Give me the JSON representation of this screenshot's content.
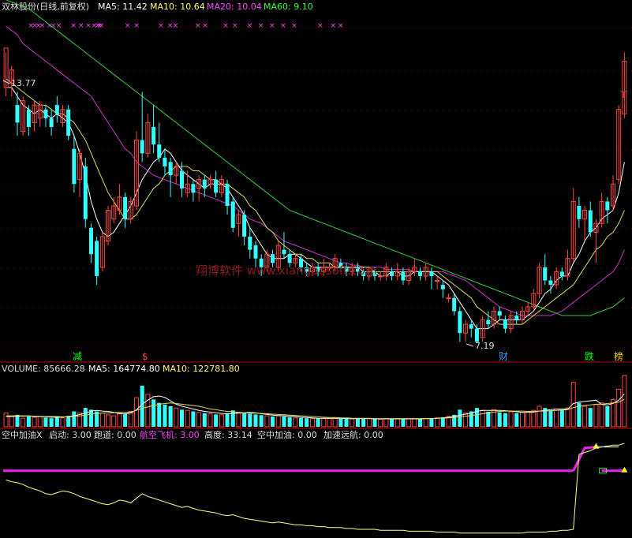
{
  "chart_data": {
    "type": "candlestick",
    "header": {
      "stock_name": "双林股份(日线,前复权)",
      "ma5": "MA5: 11.42",
      "ma10": "MA10: 10.64",
      "ma20": "MA20: 10.04",
      "ma60": "MA60: 9.10"
    },
    "price_high_label": "13.77",
    "price_low_label": "7.19",
    "watermark": "翔博软件 www.xiangbosoft.com",
    "markers": [
      {
        "text": "减",
        "color": "#00ff00"
      },
      {
        "text": "$",
        "color": "#ff3333"
      },
      {
        "text": "财",
        "color": "#3399ff"
      },
      {
        "text": "跌",
        "color": "#00ff00"
      },
      {
        "text": "榜",
        "color": "#ffcc00"
      }
    ],
    "volume_header": {
      "volume": "VOLUME: 85666.28",
      "ma5": "MA5: 164774.80",
      "ma10": "MA10: 122781.80"
    },
    "indicator_header": {
      "name": "空中加油X",
      "start": "启动: 3.00",
      "runway": "跑道: 0.00",
      "flight": "航空飞机: 3.00",
      "height": "高度: 33.14",
      "refuel": "空中加油: 0.00",
      "accel": "加速远航: 0.00"
    },
    "price_range": [
      6.9,
      14.6
    ],
    "candles": [
      [
        13.0,
        13.9,
        13.8,
        12.8
      ],
      [
        13.1,
        13.4,
        13.5,
        12.8
      ],
      [
        12.6,
        12.2,
        12.9,
        11.9
      ],
      [
        12.0,
        12.7,
        12.8,
        11.9
      ],
      [
        12.5,
        12.1,
        12.6,
        11.9
      ],
      [
        12.2,
        12.6,
        12.7,
        12.0
      ],
      [
        12.3,
        12.6,
        12.7,
        12.1
      ],
      [
        12.5,
        12.3,
        12.6,
        12.1
      ],
      [
        12.3,
        12.1,
        12.5,
        11.9
      ],
      [
        12.6,
        12.4,
        12.8,
        12.2
      ],
      [
        12.2,
        12.5,
        12.6,
        12.1
      ],
      [
        12.5,
        11.9,
        12.6,
        11.8
      ],
      [
        11.6,
        10.8,
        11.9,
        10.6
      ],
      [
        10.9,
        11.5,
        11.6,
        10.5
      ],
      [
        11.2,
        10.0,
        11.4,
        9.8
      ],
      [
        9.8,
        9.2,
        9.9,
        9.0
      ],
      [
        9.5,
        8.7,
        9.6,
        8.5
      ],
      [
        8.9,
        9.6,
        9.7,
        8.8
      ],
      [
        9.5,
        10.2,
        10.3,
        9.4
      ],
      [
        10.0,
        10.3,
        10.5,
        9.9
      ],
      [
        10.2,
        10.5,
        10.8,
        10.1
      ],
      [
        10.5,
        10.0,
        10.6,
        9.8
      ],
      [
        10.0,
        10.4,
        10.5,
        9.9
      ],
      [
        10.3,
        11.8,
        12.0,
        10.2
      ],
      [
        11.8,
        11.5,
        12.9,
        11.3
      ],
      [
        11.5,
        12.2,
        12.4,
        11.4
      ],
      [
        12.1,
        11.7,
        12.6,
        11.5
      ],
      [
        11.7,
        11.4,
        12.2,
        11.3
      ],
      [
        11.4,
        11.2,
        11.6,
        11.0
      ],
      [
        11.3,
        11.0,
        11.4,
        10.5
      ],
      [
        11.0,
        11.2,
        11.3,
        10.8
      ],
      [
        11.1,
        10.7,
        11.3,
        10.5
      ],
      [
        10.6,
        10.8,
        11.1,
        10.5
      ],
      [
        10.8,
        10.6,
        10.9,
        10.4
      ],
      [
        10.7,
        10.9,
        11.0,
        10.4
      ],
      [
        10.9,
        10.7,
        11.0,
        10.5
      ],
      [
        10.8,
        10.9,
        11.0,
        10.7
      ],
      [
        10.9,
        10.6,
        11.1,
        10.5
      ],
      [
        10.6,
        10.9,
        11.0,
        10.5
      ],
      [
        10.8,
        10.3,
        10.9,
        10.1
      ],
      [
        10.4,
        9.8,
        10.5,
        9.7
      ],
      [
        9.9,
        10.1,
        10.2,
        9.6
      ],
      [
        10.1,
        9.6,
        10.2,
        9.4
      ],
      [
        9.6,
        9.3,
        9.8,
        9.1
      ],
      [
        9.4,
        9.1,
        9.5,
        8.9
      ],
      [
        9.1,
        8.9,
        9.2,
        8.7
      ],
      [
        8.9,
        9.2,
        9.3,
        8.8
      ],
      [
        9.2,
        9.0,
        9.3,
        8.9
      ],
      [
        8.9,
        9.4,
        9.5,
        8.8
      ],
      [
        9.3,
        9.2,
        9.7,
        9.1
      ],
      [
        9.2,
        9.0,
        9.3,
        8.9
      ],
      [
        9.0,
        9.1,
        9.2,
        8.9
      ],
      [
        9.1,
        8.9,
        9.2,
        8.8
      ],
      [
        8.9,
        8.8,
        9.0,
        8.7
      ],
      [
        8.8,
        8.9,
        9.0,
        8.7
      ],
      [
        8.9,
        8.8,
        9.0,
        8.7
      ],
      [
        8.8,
        8.9,
        9.1,
        8.7
      ],
      [
        8.9,
        8.9,
        9.0,
        8.8
      ],
      [
        8.9,
        9.1,
        9.2,
        8.8
      ],
      [
        9.0,
        8.9,
        9.1,
        8.8
      ],
      [
        8.9,
        8.8,
        9.0,
        8.7
      ],
      [
        8.8,
        8.9,
        9.0,
        8.7
      ],
      [
        8.9,
        8.8,
        9.0,
        8.7
      ],
      [
        8.8,
        8.7,
        8.9,
        8.6
      ],
      [
        8.7,
        8.8,
        8.9,
        8.6
      ],
      [
        8.8,
        8.7,
        8.9,
        8.6
      ],
      [
        8.7,
        8.7,
        8.8,
        8.6
      ],
      [
        8.7,
        8.9,
        9.0,
        8.6
      ],
      [
        8.8,
        8.7,
        8.9,
        8.6
      ],
      [
        8.7,
        8.8,
        9.0,
        8.6
      ],
      [
        8.8,
        8.6,
        8.9,
        8.5
      ],
      [
        8.6,
        8.8,
        8.9,
        8.5
      ],
      [
        8.8,
        8.9,
        9.1,
        8.7
      ],
      [
        8.8,
        8.7,
        8.9,
        8.6
      ],
      [
        8.7,
        8.9,
        9.0,
        8.6
      ],
      [
        8.8,
        8.7,
        8.9,
        8.4
      ],
      [
        8.6,
        8.6,
        8.7,
        8.4
      ],
      [
        8.5,
        8.4,
        8.6,
        8.2
      ],
      [
        8.2,
        8.2,
        8.3,
        8.1
      ],
      [
        8.2,
        7.9,
        8.3,
        7.8
      ],
      [
        7.9,
        7.4,
        8.0,
        7.2
      ],
      [
        7.4,
        7.6,
        7.7,
        7.2
      ],
      [
        7.6,
        7.5,
        7.7,
        7.3
      ],
      [
        7.5,
        7.2,
        7.6,
        7.19
      ],
      [
        7.3,
        7.7,
        7.8,
        7.2
      ],
      [
        7.7,
        7.6,
        7.9,
        7.5
      ],
      [
        7.6,
        7.9,
        8.0,
        7.5
      ],
      [
        7.9,
        7.8,
        8.0,
        7.7
      ],
      [
        7.7,
        7.5,
        7.8,
        7.4
      ],
      [
        7.5,
        7.8,
        7.9,
        7.4
      ],
      [
        7.8,
        7.7,
        7.9,
        7.6
      ],
      [
        7.7,
        7.9,
        8.0,
        7.6
      ],
      [
        7.9,
        8.0,
        8.1,
        7.8
      ],
      [
        8.0,
        8.3,
        8.4,
        7.9
      ],
      [
        8.3,
        8.9,
        9.0,
        8.2
      ],
      [
        8.9,
        8.6,
        9.2,
        8.5
      ],
      [
        8.6,
        8.5,
        8.7,
        8.3
      ],
      [
        8.5,
        8.8,
        8.9,
        8.4
      ],
      [
        8.8,
        8.7,
        8.9,
        8.6
      ],
      [
        8.7,
        9.1,
        9.3,
        8.6
      ],
      [
        9.1,
        10.4,
        10.7,
        9.0
      ],
      [
        10.3,
        10.0,
        10.5,
        9.8
      ],
      [
        10.0,
        10.2,
        10.3,
        9.5
      ],
      [
        10.2,
        9.7,
        10.4,
        9.6
      ],
      [
        9.7,
        9.9,
        10.0,
        9.0
      ],
      [
        9.9,
        10.4,
        10.6,
        9.8
      ],
      [
        10.4,
        10.2,
        10.5,
        9.9
      ],
      [
        10.3,
        10.8,
        11.0,
        10.2
      ],
      [
        10.9,
        12.5,
        12.6,
        10.8
      ],
      [
        12.4,
        13.6,
        13.8,
        12.3
      ]
    ],
    "ma5": [
      13.0,
      13.0,
      12.8,
      12.6,
      12.5,
      12.4,
      12.5,
      12.4,
      12.3,
      12.4,
      12.3,
      12.2,
      11.9,
      11.5,
      11.0,
      10.4,
      10.0,
      9.7,
      9.6,
      9.7,
      9.9,
      10.1,
      10.3,
      10.6,
      10.9,
      11.1,
      11.3,
      11.4,
      11.6,
      11.5,
      11.3,
      11.1,
      11.0,
      10.9,
      10.8,
      10.7,
      10.8,
      10.8,
      10.8,
      10.7,
      10.5,
      10.3,
      10.1,
      9.8,
      9.6,
      9.4,
      9.2,
      9.1,
      9.1,
      9.1,
      9.2,
      9.2,
      9.1,
      9.0,
      8.9,
      8.9,
      8.9,
      8.9,
      8.9,
      8.9,
      8.9,
      8.9,
      8.9,
      8.8,
      8.8,
      8.8,
      8.7,
      8.7,
      8.8,
      8.8,
      8.7,
      8.7,
      8.8,
      8.8,
      8.8,
      8.8,
      8.7,
      8.6,
      8.5,
      8.3,
      8.1,
      7.9,
      7.7,
      7.5,
      7.5,
      7.5,
      7.6,
      7.7,
      7.7,
      7.7,
      7.7,
      7.7,
      7.8,
      7.9,
      8.1,
      8.3,
      8.4,
      8.6,
      8.7,
      8.7,
      9.0,
      9.2,
      9.5,
      9.7,
      9.8,
      10.0,
      10.1,
      10.2,
      10.6,
      11.3
    ],
    "ma10": [
      13.2,
      13.1,
      13.0,
      12.9,
      12.8,
      12.7,
      12.6,
      12.6,
      12.5,
      12.4,
      12.4,
      12.3,
      12.2,
      12.0,
      11.8,
      11.5,
      11.2,
      10.9,
      10.6,
      10.4,
      10.2,
      10.0,
      10.0,
      10.1,
      10.3,
      10.5,
      10.7,
      10.8,
      11.0,
      11.1,
      11.2,
      11.2,
      11.2,
      11.1,
      11.1,
      11.0,
      10.9,
      10.9,
      10.8,
      10.8,
      10.7,
      10.6,
      10.5,
      10.3,
      10.2,
      10.0,
      9.8,
      9.7,
      9.5,
      9.4,
      9.3,
      9.2,
      9.2,
      9.1,
      9.1,
      9.0,
      9.0,
      9.0,
      8.9,
      8.9,
      8.9,
      8.9,
      8.9,
      8.9,
      8.9,
      8.8,
      8.8,
      8.8,
      8.8,
      8.8,
      8.8,
      8.8,
      8.8,
      8.8,
      8.8,
      8.8,
      8.8,
      8.7,
      8.6,
      8.5,
      8.4,
      8.3,
      8.2,
      8.0,
      7.9,
      7.8,
      7.7,
      7.6,
      7.6,
      7.6,
      7.6,
      7.6,
      7.7,
      7.8,
      7.9,
      8.0,
      8.1,
      8.2,
      8.3,
      8.4,
      8.5,
      8.7,
      8.9,
      9.1,
      9.3,
      9.4,
      9.6,
      9.7,
      9.9,
      10.2
    ],
    "ma20": [
      14.4,
      14.3,
      14.2,
      14.0,
      13.9,
      13.8,
      13.7,
      13.6,
      13.5,
      13.4,
      13.3,
      13.2,
      13.1,
      13.0,
      12.9,
      12.8,
      12.6,
      12.4,
      12.2,
      12.0,
      11.8,
      11.6,
      11.5,
      11.3,
      11.2,
      11.1,
      11.0,
      10.95,
      10.9,
      10.85,
      10.8,
      10.75,
      10.7,
      10.65,
      10.6,
      10.55,
      10.5,
      10.45,
      10.4,
      10.35,
      10.3,
      10.2,
      10.1,
      10.0,
      9.95,
      9.9,
      9.8,
      9.7,
      9.6,
      9.5,
      9.45,
      9.4,
      9.35,
      9.3,
      9.25,
      9.2,
      9.15,
      9.1,
      9.05,
      9.0,
      9.0,
      8.95,
      8.95,
      8.9,
      8.9,
      8.9,
      8.9,
      8.85,
      8.85,
      8.85,
      8.85,
      8.85,
      8.8,
      8.8,
      8.8,
      8.8,
      8.8,
      8.8,
      8.75,
      8.7,
      8.65,
      8.6,
      8.5,
      8.4,
      8.3,
      8.2,
      8.1,
      8.0,
      7.95,
      7.9,
      7.85,
      7.8,
      7.8,
      7.8,
      7.8,
      7.8,
      7.8,
      7.85,
      7.9,
      8.0,
      8.1,
      8.2,
      8.3,
      8.4,
      8.5,
      8.6,
      8.7,
      8.8,
      9.0,
      9.3
    ],
    "ma60": [
      15.0,
      14.95,
      14.9,
      14.85,
      14.8,
      14.7,
      14.6,
      14.5,
      14.4,
      14.3,
      14.2,
      14.1,
      14.0,
      13.9,
      13.8,
      13.7,
      13.6,
      13.5,
      13.4,
      13.3,
      13.2,
      13.1,
      13.0,
      12.9,
      12.8,
      12.7,
      12.6,
      12.5,
      12.4,
      12.3,
      12.2,
      12.1,
      12.0,
      11.9,
      11.8,
      11.7,
      11.6,
      11.5,
      11.4,
      11.3,
      11.2,
      11.1,
      11.0,
      10.9,
      10.8,
      10.7,
      10.6,
      10.5,
      10.4,
      10.3,
      10.2,
      10.15,
      10.1,
      10.05,
      10.0,
      9.95,
      9.9,
      9.85,
      9.8,
      9.75,
      9.7,
      9.65,
      9.6,
      9.55,
      9.5,
      9.45,
      9.4,
      9.35,
      9.3,
      9.25,
      9.2,
      9.15,
      9.1,
      9.05,
      9.0,
      8.95,
      8.9,
      8.85,
      8.8,
      8.75,
      8.7,
      8.65,
      8.6,
      8.55,
      8.5,
      8.45,
      8.4,
      8.35,
      8.3,
      8.25,
      8.2,
      8.15,
      8.1,
      8.05,
      8.0,
      7.95,
      7.9,
      7.85,
      7.8,
      7.8,
      7.8,
      7.8,
      7.8,
      7.8,
      7.85,
      7.9,
      7.95,
      8.0,
      8.1,
      8.2
    ],
    "volumes": [
      40,
      30,
      35,
      25,
      30,
      28,
      30,
      27,
      25,
      30,
      26,
      32,
      45,
      40,
      55,
      50,
      45,
      40,
      35,
      32,
      40,
      38,
      45,
      85,
      120,
      95,
      80,
      70,
      65,
      60,
      55,
      50,
      48,
      45,
      42,
      40,
      38,
      36,
      35,
      40,
      48,
      42,
      40,
      38,
      36,
      34,
      32,
      30,
      32,
      30,
      28,
      26,
      26,
      25,
      24,
      24,
      25,
      24,
      25,
      24,
      23,
      23,
      24,
      23,
      24,
      23,
      22,
      24,
      23,
      24,
      22,
      23,
      24,
      23,
      24,
      25,
      26,
      28,
      30,
      35,
      50,
      40,
      45,
      55,
      48,
      44,
      50,
      42,
      40,
      44,
      40,
      42,
      44,
      48,
      60,
      55,
      48,
      52,
      50,
      55,
      130,
      70,
      60,
      55,
      65,
      70,
      60,
      80,
      110,
      150
    ],
    "volume_ma5": [
      30,
      30,
      31,
      31,
      32,
      30,
      30,
      29,
      28,
      28,
      28,
      30,
      32,
      36,
      40,
      46,
      48,
      46,
      45,
      42,
      38,
      38,
      40,
      50,
      66,
      78,
      88,
      90,
      86,
      76,
      66,
      60,
      56,
      52,
      48,
      45,
      43,
      41,
      39,
      38,
      39,
      40,
      41,
      42,
      41,
      38,
      36,
      34,
      33,
      32,
      31,
      30,
      28,
      27,
      26,
      25,
      25,
      25,
      25,
      25,
      24,
      24,
      24,
      24,
      24,
      23,
      23,
      23,
      23,
      23,
      23,
      23,
      23,
      23,
      24,
      24,
      25,
      26,
      28,
      30,
      34,
      37,
      40,
      45,
      48,
      48,
      48,
      48,
      47,
      46,
      44,
      42,
      42,
      43,
      46,
      48,
      50,
      52,
      52,
      52,
      68,
      72,
      74,
      76,
      78,
      65,
      64,
      68,
      78,
      96
    ],
    "volume_ma10": [
      32,
      32,
      32,
      32,
      32,
      31,
      31,
      30,
      30,
      30,
      29,
      29,
      30,
      32,
      34,
      37,
      39,
      40,
      41,
      41,
      42,
      42,
      43,
      48,
      54,
      58,
      62,
      66,
      68,
      70,
      68,
      66,
      64,
      62,
      60,
      56,
      52,
      50,
      47,
      45,
      44,
      42,
      41,
      40,
      40,
      39,
      38,
      37,
      36,
      35,
      34,
      33,
      32,
      31,
      30,
      29,
      28,
      27,
      27,
      26,
      26,
      25,
      25,
      25,
      25,
      24,
      24,
      24,
      24,
      24,
      24,
      24,
      24,
      24,
      24,
      24,
      25,
      25,
      26,
      27,
      29,
      31,
      33,
      35,
      38,
      41,
      43,
      45,
      46,
      46,
      46,
      46,
      45,
      45,
      46,
      46,
      47,
      48,
      49,
      50,
      56,
      60,
      62,
      64,
      66,
      66,
      68,
      70,
      72,
      80
    ],
    "indicator_line": [
      60,
      58,
      57,
      55,
      52,
      50,
      48,
      45,
      44,
      46,
      48,
      47,
      45,
      42,
      40,
      38,
      36,
      34,
      33,
      35,
      38,
      37,
      35,
      40,
      45,
      42,
      40,
      38,
      36,
      34,
      32,
      30,
      31,
      29,
      27,
      26,
      25,
      24,
      22,
      21,
      22,
      20,
      18,
      17,
      16,
      15,
      14,
      13,
      14,
      13,
      12,
      11,
      11,
      10,
      10,
      9,
      9,
      8,
      8,
      8,
      7,
      7,
      6,
      6,
      6,
      6,
      5,
      5,
      5,
      5,
      5,
      4,
      4,
      4,
      4,
      4,
      3,
      3,
      3,
      3,
      2,
      2,
      2,
      2,
      2,
      2,
      2,
      2,
      2,
      2,
      2,
      2,
      3,
      3,
      3,
      3,
      4,
      4,
      5,
      5,
      6,
      88,
      90,
      92,
      95,
      96,
      97,
      98,
      98,
      100
    ],
    "indicator_flat_level": 70
  }
}
